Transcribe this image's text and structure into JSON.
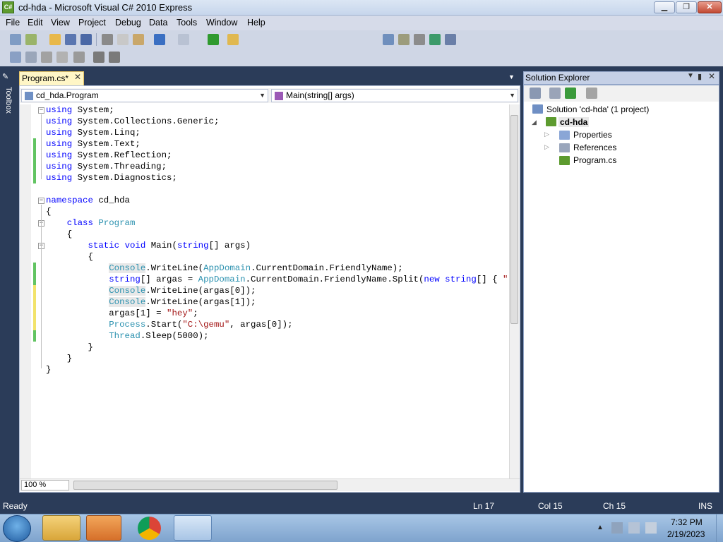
{
  "window": {
    "title": "cd-hda - Microsoft Visual C# 2010 Express",
    "app_icon": "C#"
  },
  "menu": [
    "File",
    "Edit",
    "View",
    "Project",
    "Debug",
    "Data",
    "Tools",
    "Window",
    "Help"
  ],
  "toolbox_label": "Toolbox",
  "tab": {
    "label": "Program.cs*"
  },
  "nav": {
    "class_combo": "cd_hda.Program",
    "member_combo": "Main(string[] args)"
  },
  "code_lines": [
    "using System;",
    "using System.Collections.Generic;",
    "using System.Linq;",
    "using System.Text;",
    "using System.Reflection;",
    "using System.Threading;",
    "using System.Diagnostics;",
    "",
    "namespace cd_hda",
    "{",
    "    class Program",
    "    {",
    "        static void Main(string[] args)",
    "        {",
    "            Console.WriteLine(AppDomain.CurrentDomain.FriendlyName);",
    "            string[] argas = AppDomain.CurrentDomain.FriendlyName.Split(new string[] { \"-\" },",
    "            Console.WriteLine(argas[0]);",
    "            Console.WriteLine(argas[1]);",
    "            argas[1] = \"hey\";",
    "            Process.Start(\"C:\\gemu\", argas[0]);",
    "            Thread.Sleep(5000);",
    "        }",
    "    }",
    "}"
  ],
  "zoom": "100 %",
  "solution_explorer": {
    "title": "Solution Explorer",
    "solution": "Solution 'cd-hda' (1 project)",
    "project": "cd-hda",
    "items": [
      "Properties",
      "References",
      "Program.cs"
    ]
  },
  "status": {
    "state": "Ready",
    "ln": "Ln 17",
    "col": "Col 15",
    "ch": "Ch 15",
    "mode": "INS"
  },
  "clock": {
    "time": "7:32 PM",
    "date": "2/19/2023"
  },
  "colors": {
    "keyword": "#0000ff",
    "type": "#2b91af",
    "string": "#a31515",
    "accent": "#2b3c59"
  }
}
